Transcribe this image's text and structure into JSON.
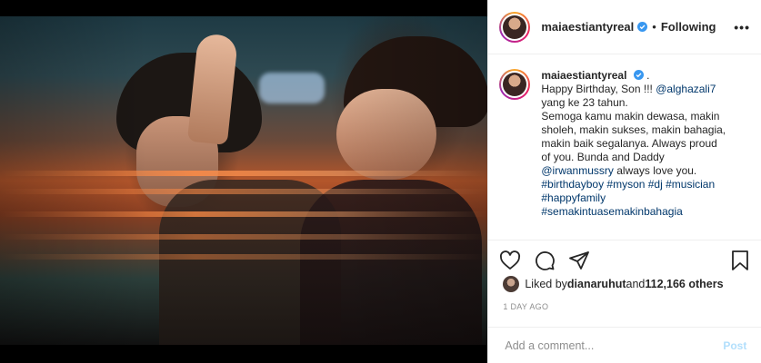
{
  "post": {
    "username": "maiaestiantyreal",
    "follow_status": "Following",
    "dot": "•",
    "more": "•••"
  },
  "caption": {
    "username": "maiaestiantyreal",
    "after_name": ".",
    "line1_pre": "Happy Birthday, Son !!! ",
    "mention1": "@alghazali7",
    "line2": "yang ke 23 tahun.",
    "line3": "Semoga kamu makin dewasa, makin",
    "line4": "sholeh, makin sukses, makin bahagia,",
    "line5": "makin baik segalanya. Always proud",
    "line6": "of you. Bunda and Daddy",
    "mention2": "@irwanmussry",
    "line7_post": " always love you.",
    "hashtags_line1": "#birthdayboy #myson #dj #musician",
    "hashtags_line2": "#happyfamily",
    "hashtags_line3": "#semakintuasemakinbahagia"
  },
  "likes": {
    "prefix": "Liked by ",
    "user": "dianaruhut",
    "middle": " and ",
    "count": "112,166 others"
  },
  "timestamp": "1 DAY AGO",
  "comment": {
    "placeholder": "Add a comment...",
    "post_label": "Post"
  },
  "colors": {
    "verified": "#3897f0",
    "link": "#00376b",
    "post_disabled": "#b2dffc",
    "muted": "#8e8e8e"
  },
  "icons": {
    "like": "heart-icon",
    "comment": "comment-icon",
    "share": "share-icon",
    "save": "bookmark-icon"
  }
}
